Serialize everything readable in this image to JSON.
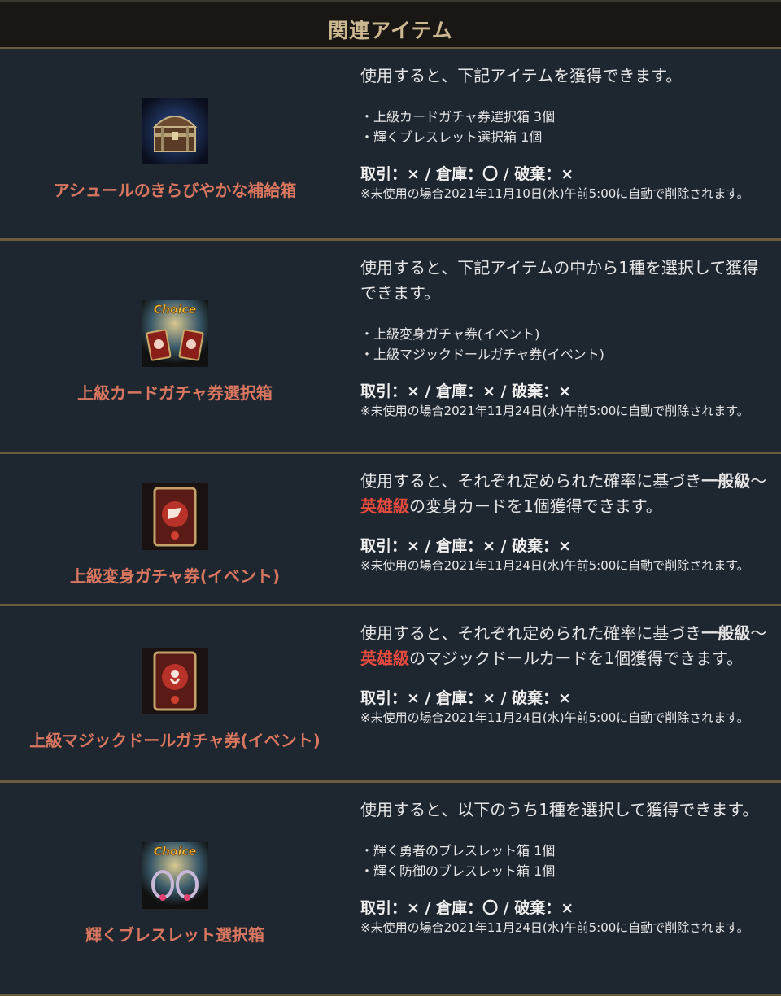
{
  "header": {
    "title": "関連アイテム"
  },
  "items": [
    {
      "name": "アシュールのきらびやかな補給箱",
      "icon": "treasure-chest-icon",
      "desc": "使用すると、下記アイテムを獲得できます。",
      "list": [
        "・上級カードガチャ券選択箱 3個",
        "・輝くブレスレット選択箱 1個"
      ],
      "trade": "取引：× / 倉庫：〇 / 破棄：×",
      "note": "※未使用の場合2021年11月10日(水)午前5:00に自動で削除されます。"
    },
    {
      "name": "上級カードガチャ券選択箱",
      "icon": "choice-card-box-icon",
      "choice_label": "Choice",
      "desc": "使用すると、下記アイテムの中から1種を選択して獲得できます。",
      "list": [
        "・上級変身ガチャ券(イベント)",
        "・上級マジックドールガチャ券(イベント)"
      ],
      "trade": "取引：× / 倉庫：× / 破棄：×",
      "note": "※未使用の場合2021年11月24日(水)午前5:00に自動で削除されます。"
    },
    {
      "name": "上級変身ガチャ券(イベント)",
      "icon": "transform-card-icon",
      "desc_a": "使用すると、それぞれ定められた確率に基づき",
      "desc_b": "一般級",
      "desc_c": "～",
      "desc_d": "英雄級",
      "desc_e": "の変身カードを1個獲得できます。",
      "trade": "取引：× / 倉庫：× / 破棄：×",
      "note": "※未使用の場合2021年11月24日(水)午前5:00に自動で削除されます。"
    },
    {
      "name": "上級マジックドールガチャ券(イベント)",
      "icon": "magic-doll-card-icon",
      "desc_a": "使用すると、それぞれ定められた確率に基づき",
      "desc_b": "一般級",
      "desc_c": "～",
      "desc_d": "英雄級",
      "desc_e": "のマジックドールカードを1個獲得できます。",
      "trade": "取引：× / 倉庫：× / 破棄：×",
      "note": "※未使用の場合2021年11月24日(水)午前5:00に自動で削除されます。"
    },
    {
      "name": "輝くブレスレット選択箱",
      "icon": "choice-bracelet-box-icon",
      "choice_label": "Choice",
      "desc": "使用すると、以下のうち1種を選択して獲得できます。",
      "list": [
        "・輝く勇者のブレスレット箱 1個",
        "・輝く防御のブレスレット箱 1個"
      ],
      "trade": "取引：× / 倉庫：〇 / 破棄：×",
      "note": "※未使用の場合2021年11月24日(水)午前5:00に自動で削除されます。"
    }
  ],
  "colors": {
    "background": "#1e2630",
    "header_bg": "#1a1614",
    "header_text": "#cbb790",
    "divider": "#6b5a3e",
    "item_name": "#d8765f",
    "highlight_red": "#e84a3e"
  }
}
